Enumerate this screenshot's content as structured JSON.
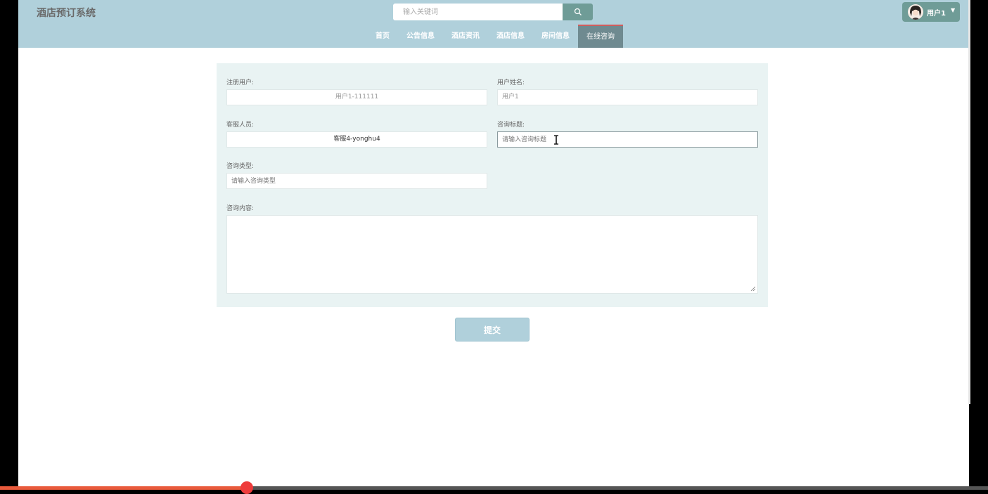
{
  "header": {
    "logo": "酒店预订系统",
    "search": {
      "placeholder": "输入关键词"
    },
    "user": {
      "name": "用户1"
    }
  },
  "nav": {
    "items": [
      {
        "label": "首页"
      },
      {
        "label": "公告信息"
      },
      {
        "label": "酒店资讯"
      },
      {
        "label": "酒店信息"
      },
      {
        "label": "房间信息"
      },
      {
        "label": "在线咨询",
        "active": true
      }
    ]
  },
  "form": {
    "registered_user": {
      "label": "注册用户:",
      "value": "用户1-111111"
    },
    "user_name": {
      "label": "用户姓名:",
      "value": "用户1"
    },
    "service_staff": {
      "label": "客服人员:",
      "value": "客服4-yonghu4"
    },
    "consult_title": {
      "label": "咨询标题:",
      "placeholder": "请输入咨询标题"
    },
    "consult_type": {
      "label": "咨询类型:",
      "placeholder": "请输入咨询类型"
    },
    "consult_content": {
      "label": "咨询内容:"
    },
    "submit_label": "提交"
  },
  "colors": {
    "header_bg": "#b0d0db",
    "accent": "#6f9c97",
    "panel_bg": "#e9f3f3"
  },
  "video_progress": {
    "fraction": 0.25
  }
}
